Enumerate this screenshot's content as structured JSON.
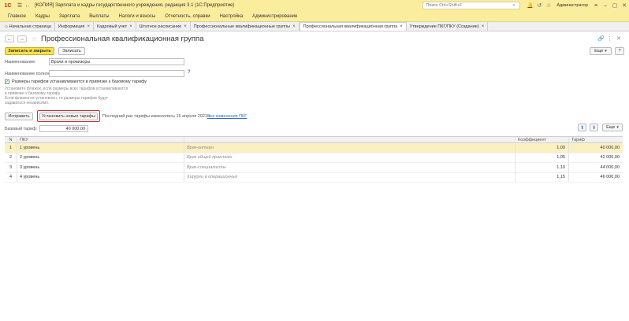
{
  "app": {
    "logo": "1С",
    "title": "[КОПИЯ] Зарплата и кадры государственного учреждения, редакция 3.1  (1С:Предприятие)",
    "search_placeholder": "Поиск Ctrl+Shift+F",
    "user": "Администратор"
  },
  "menu": [
    "Главное",
    "Кадры",
    "Зарплата",
    "Выплаты",
    "Налоги и взносы",
    "Отчетность, справки",
    "Настройка",
    "Администрирование"
  ],
  "tabs": [
    {
      "label": "Начальная страница",
      "active": false,
      "home": true
    },
    {
      "label": "Информация",
      "active": false
    },
    {
      "label": "Кадровый учет",
      "active": false
    },
    {
      "label": "Штатное расписание",
      "active": false
    },
    {
      "label": "Профессиональные квалификационные группы",
      "active": false
    },
    {
      "label": "Профессиональная квалификационная группа",
      "active": true
    },
    {
      "label": "Утверждение ПКГ/ПКУ (Создание)",
      "active": false
    }
  ],
  "form": {
    "title": "Профессиональная квалификационная группа",
    "save_close_label": "Записать и закрыть",
    "save_label": "Записать",
    "more_label": "Еще",
    "name_label": "Наименование:",
    "name_value": "Врачи и провизоры",
    "fullname_label": "Наименование полное:",
    "fullname_value": "",
    "help_mark": "?",
    "checkbox_label": "Размеры тарифов устанавливаются в привязке к базовому тарифу",
    "hint_lines": [
      "Установите флажок, если размеры всех тарифов устанавливаются",
      "в привязке к базовому тарифу.",
      "Если флажок не установлен, то размеры тарифов будут",
      "задаваться независимо."
    ],
    "fix_label": "Исправить",
    "set_tariffs_label": "Установить новые тарифы",
    "last_change_text": "Последний раз тарифы изменялись 15 апреля 2021 г.",
    "all_changes_link": "Все изменения ПКГ",
    "base_tariff_label": "Базовый тариф:",
    "base_tariff_value": "40 000,00",
    "more2_label": "Еще"
  },
  "table": {
    "headers": {
      "n": "N",
      "pku": "ПКУ",
      "desc": "",
      "coef": "Коэффициент",
      "tarif": "Тариф"
    },
    "rows": [
      {
        "n": "1",
        "pku": "1 уровень",
        "desc": "Врач-интерн",
        "coef": "1,00",
        "tarif": "40 000,00",
        "selected": true
      },
      {
        "n": "2",
        "pku": "2 уровень",
        "desc": "Врач общей практики",
        "coef": "1,05",
        "tarif": "42 000,00",
        "selected": false
      },
      {
        "n": "3",
        "pku": "3 уровень",
        "desc": "Врач-специалисты",
        "coef": "1,10",
        "tarif": "44 000,00",
        "selected": false
      },
      {
        "n": "4",
        "pku": "4 уровень",
        "desc": "Хирурги в операционных",
        "coef": "1,15",
        "tarif": "46 000,00",
        "selected": false
      }
    ]
  }
}
